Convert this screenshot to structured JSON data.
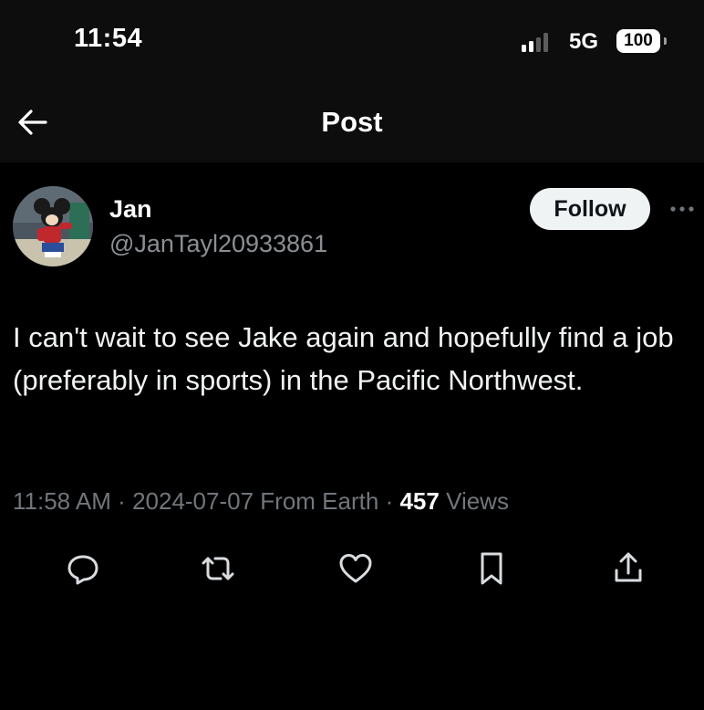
{
  "status_bar": {
    "time": "11:54",
    "network": "5G",
    "battery": "100",
    "signal_bars_active": 2,
    "signal_bars_total": 4
  },
  "header": {
    "title": "Post",
    "back_icon": "arrow-left-icon"
  },
  "post": {
    "author": {
      "name": "Jan",
      "handle": "@JanTayl20933861"
    },
    "follow_label": "Follow",
    "text": "I can't wait to see Jake again and hopefully find a job (preferably in sports) in the Pacific Northwest.",
    "meta": {
      "time": "11:58 AM",
      "date": "2024-07-07",
      "location": "From Earth",
      "views": "457",
      "views_label": "Views"
    },
    "actions": [
      "reply-icon",
      "repost-icon",
      "like-icon",
      "bookmark-icon",
      "share-icon"
    ]
  },
  "colors": {
    "background": "#000000",
    "header_background": "#0d0d0d",
    "text_primary": "#ffffff",
    "text_secondary": "#71767b",
    "follow_button_bg": "#eff3f4"
  }
}
